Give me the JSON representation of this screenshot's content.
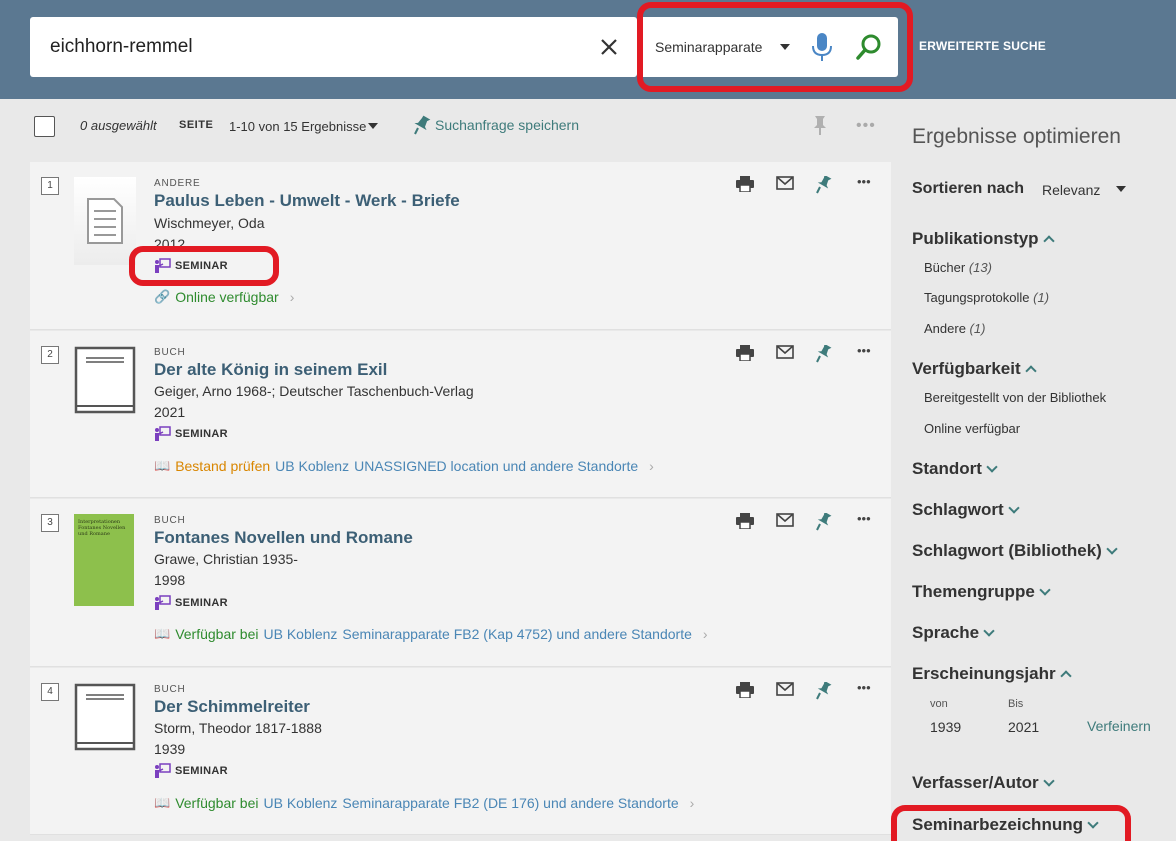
{
  "search": {
    "query": "eichhorn-remmel",
    "scope": "Seminarapparate",
    "advanced_label": "ERWEITERTE SUCHE"
  },
  "toolbar": {
    "selected": "0 ausgewählt",
    "page_label": "SEITE",
    "range": "1-10 von 15 Ergebnisse",
    "save_query": "Suchanfrage speichern"
  },
  "results": [
    {
      "num": "1",
      "type": "ANDERE",
      "title": "Paulus Leben - Umwelt - Werk - Briefe",
      "author": "Wischmeyer, Oda",
      "year": "2012",
      "badge": "SEMINAR",
      "avail_status": "Online verfügbar",
      "avail_loc": "",
      "avail_rest": ""
    },
    {
      "num": "2",
      "type": "BUCH",
      "title": "Der alte König in seinem Exil",
      "author": "Geiger, Arno 1968-; Deutscher Taschenbuch-Verlag",
      "year": "2021",
      "badge": "SEMINAR",
      "avail_status": "Bestand prüfen",
      "avail_loc": "UB Koblenz",
      "avail_rest": "UNASSIGNED location und andere Standorte"
    },
    {
      "num": "3",
      "type": "BUCH",
      "title": "Fontanes Novellen und Romane",
      "author": "Grawe, Christian 1935-",
      "year": "1998",
      "badge": "SEMINAR",
      "avail_status": "Verfügbar bei",
      "avail_loc": "UB Koblenz",
      "avail_rest": "Seminarapparate FB2 (Kap 4752) und andere Standorte",
      "cover_text": "Interpretationen Fontanes Novellen und Romane"
    },
    {
      "num": "4",
      "type": "BUCH",
      "title": "Der Schimmelreiter",
      "author": "Storm, Theodor 1817-1888",
      "year": "1939",
      "badge": "SEMINAR",
      "avail_status": "Verfügbar bei",
      "avail_loc": "UB Koblenz",
      "avail_rest": "Seminarapparate FB2 (DE 176) und andere Standorte"
    }
  ],
  "sidebar": {
    "title": "Ergebnisse optimieren",
    "sort_label": "Sortieren nach",
    "sort_value": "Relevanz",
    "pubtype": {
      "label": "Publikationstyp",
      "items": [
        {
          "name": "Bücher",
          "count": "(13)"
        },
        {
          "name": "Tagungsprotokolle",
          "count": "(1)"
        },
        {
          "name": "Andere",
          "count": "(1)"
        }
      ]
    },
    "availability": {
      "label": "Verfügbarkeit",
      "items": [
        "Bereitgestellt von der Bibliothek",
        "Online verfügbar"
      ]
    },
    "collapsed": [
      "Standort",
      "Schlagwort",
      "Schlagwort (Bibliothek)",
      "Themengruppe",
      "Sprache"
    ],
    "year": {
      "label": "Erscheinungsjahr",
      "from_label": "von",
      "to_label": "Bis",
      "from": "1939",
      "to": "2021",
      "refine": "Verfeinern"
    },
    "author_facet": "Verfasser/Autor",
    "seminar_facet": "Seminarbezeichnung"
  },
  "colors": {
    "header": "#5b7891",
    "highlight": "#e21a23",
    "teal": "#3e7b7b",
    "seminar_purple": "#7b3fbf"
  }
}
